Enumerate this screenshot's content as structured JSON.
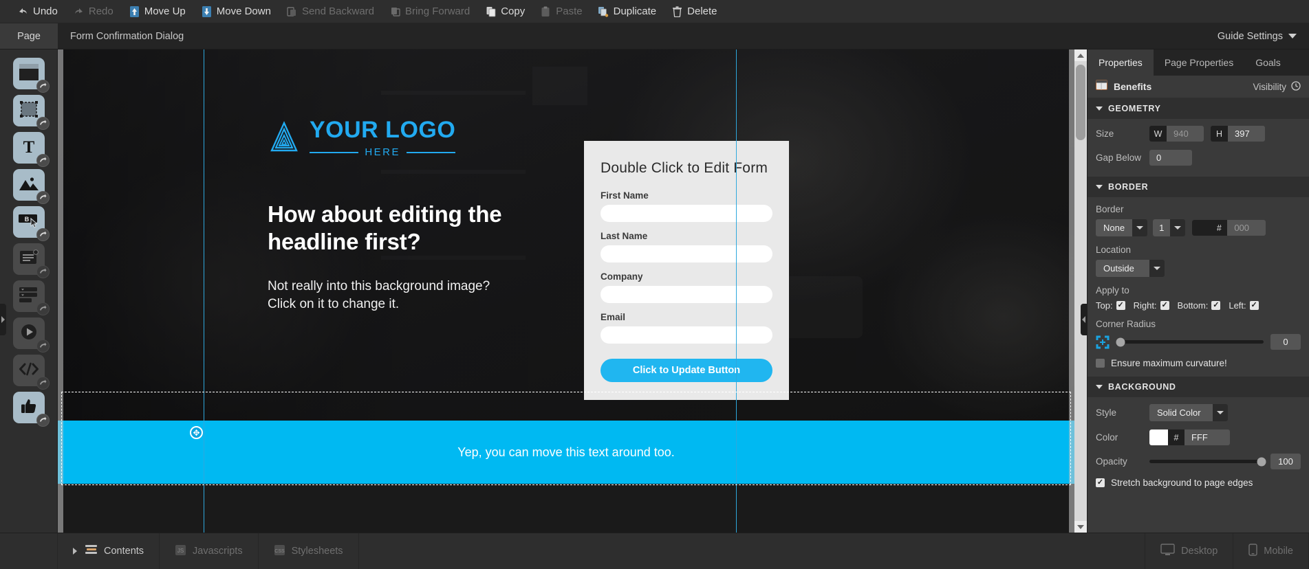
{
  "toolbar": {
    "items": [
      {
        "label": "Undo",
        "icon": "undo-arrow-icon",
        "enabled": true
      },
      {
        "label": "Redo",
        "icon": "redo-arrow-icon",
        "enabled": false
      },
      {
        "label": "Move Up",
        "icon": "move-up-icon",
        "enabled": true
      },
      {
        "label": "Move Down",
        "icon": "move-down-icon",
        "enabled": true
      },
      {
        "label": "Send Backward",
        "icon": "send-backward-icon",
        "enabled": false
      },
      {
        "label": "Bring Forward",
        "icon": "bring-forward-icon",
        "enabled": false
      },
      {
        "label": "Copy",
        "icon": "copy-icon",
        "enabled": true
      },
      {
        "label": "Paste",
        "icon": "paste-icon",
        "enabled": false
      },
      {
        "label": "Duplicate",
        "icon": "duplicate-icon",
        "enabled": true
      },
      {
        "label": "Delete",
        "icon": "trash-icon",
        "enabled": true
      }
    ]
  },
  "second_bar": {
    "page_tab": "Page",
    "document_title": "Form Confirmation Dialog",
    "guide_settings": "Guide Settings"
  },
  "left_rail": {
    "items": [
      {
        "name": "box-section-tool",
        "icon": "box-icon",
        "active": true
      },
      {
        "name": "shape-tool",
        "icon": "dashed-box-icon",
        "active": true
      },
      {
        "name": "text-tool",
        "icon": "text-T-icon",
        "active": true
      },
      {
        "name": "image-tool",
        "icon": "image-icon",
        "active": true
      },
      {
        "name": "button-tool",
        "icon": "button-cursor-icon",
        "active": true
      },
      {
        "name": "content-block-tool",
        "icon": "lines-card-icon",
        "active": false
      },
      {
        "name": "form-tool",
        "icon": "form-rows-icon",
        "active": false
      },
      {
        "name": "video-tool",
        "icon": "play-circle-icon",
        "active": false
      },
      {
        "name": "code-tool",
        "icon": "code-brackets-icon",
        "active": false
      },
      {
        "name": "social-tool",
        "icon": "thumbs-up-icon",
        "active": true
      }
    ]
  },
  "canvas": {
    "logo": {
      "main": "YOUR LOGO",
      "sub": "HERE"
    },
    "headline": "How about editing the headline first?",
    "subcopy": "Not really into this background image? Click on it to change it.",
    "form": {
      "title": "Double Click to Edit Form",
      "fields": [
        {
          "label": "First Name",
          "value": ""
        },
        {
          "label": "Last Name",
          "value": ""
        },
        {
          "label": "Company",
          "value": ""
        },
        {
          "label": "Email",
          "value": ""
        }
      ],
      "submit_label": "Click to Update Button"
    },
    "banner_text": "Yep, you can move this text around too.",
    "accent_color": "#00b9f2"
  },
  "properties": {
    "tabs": [
      {
        "label": "Properties",
        "active": true
      },
      {
        "label": "Page Properties",
        "active": false
      },
      {
        "label": "Goals",
        "active": false
      }
    ],
    "object": {
      "name": "Benefits",
      "visibility_label": "Visibility"
    },
    "geometry": {
      "title": "GEOMETRY",
      "size_label": "Size",
      "width_key": "W",
      "width_value": "940",
      "height_key": "H",
      "height_value": "397",
      "gap_below_label": "Gap Below",
      "gap_below_value": "0"
    },
    "border": {
      "title": "BORDER",
      "border_label": "Border",
      "style_value": "None",
      "width_value": "1",
      "hash": "#",
      "color_value": "000",
      "location_label": "Location",
      "location_value": "Outside",
      "apply_to_label": "Apply to",
      "apply_to": [
        {
          "label": "Top:",
          "checked": true
        },
        {
          "label": "Right:",
          "checked": true
        },
        {
          "label": "Bottom:",
          "checked": true
        },
        {
          "label": "Left:",
          "checked": true
        }
      ],
      "corner_radius_label": "Corner Radius",
      "corner_radius_value": "0",
      "corner_radius_percent": 0,
      "max_curvature_label": "Ensure maximum curvature!",
      "max_curvature_checked": false
    },
    "background": {
      "title": "BACKGROUND",
      "style_label": "Style",
      "style_value": "Solid Color",
      "color_label": "Color",
      "hash": "#",
      "color_value": "FFF",
      "color_swatch": "#FFFFFF",
      "opacity_label": "Opacity",
      "opacity_value": "100",
      "opacity_percent": 100,
      "stretch_label": "Stretch background to page edges",
      "stretch_checked": true
    }
  },
  "bottom_bar": {
    "left_items": [
      {
        "label": "Contents",
        "icon": "list-lines-icon",
        "muted": false
      },
      {
        "label": "Javascripts",
        "icon": "js-file-icon",
        "muted": true
      },
      {
        "label": "Stylesheets",
        "icon": "css-file-icon",
        "muted": true
      }
    ],
    "right_items": [
      {
        "label": "Desktop",
        "icon": "monitor-icon",
        "muted": true
      },
      {
        "label": "Mobile",
        "icon": "phone-icon",
        "muted": true
      }
    ]
  }
}
